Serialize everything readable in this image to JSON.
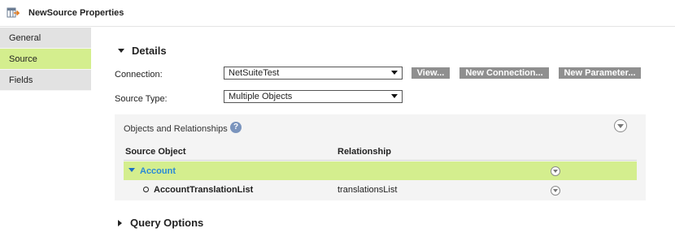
{
  "window": {
    "title": "NewSource Properties",
    "icon": "source-table-icon"
  },
  "sidebar": {
    "items": [
      {
        "label": "General",
        "active": false
      },
      {
        "label": "Source",
        "active": true
      },
      {
        "label": "Fields",
        "active": false
      }
    ]
  },
  "details": {
    "heading": "Details",
    "connection": {
      "label": "Connection:",
      "value": "NetSuiteTest",
      "buttons": {
        "view": "View...",
        "new_connection": "New Connection...",
        "new_parameter": "New Parameter..."
      }
    },
    "source_type": {
      "label": "Source Type:",
      "value": "Multiple Objects"
    }
  },
  "objects": {
    "title": "Objects and Relationships",
    "help_icon": "?",
    "columns": {
      "source_object": "Source Object",
      "relationship": "Relationship"
    },
    "rows": [
      {
        "name": "Account",
        "relationship": "",
        "expanded": true,
        "highlighted": true
      },
      {
        "name": "AccountTranslationList",
        "relationship": "translationsList",
        "expanded": false,
        "highlighted": false
      }
    ]
  },
  "query_options": {
    "heading": "Query Options",
    "expanded": false
  },
  "colors": {
    "accent": "#d4ee8e",
    "link": "#2a8ad6",
    "button": "#8f8f8f"
  }
}
